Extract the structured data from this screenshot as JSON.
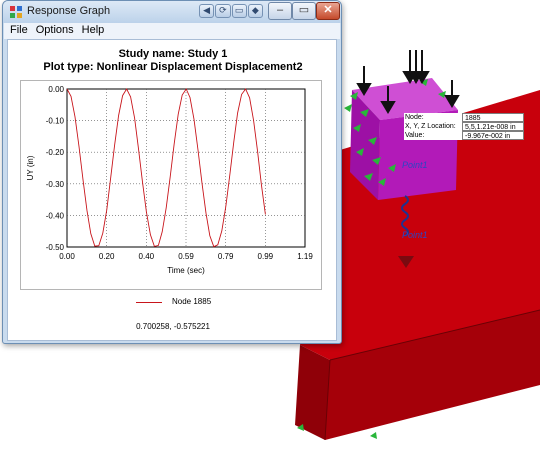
{
  "window": {
    "title": "Response Graph",
    "quick_buttons": [
      "◀",
      "⟳",
      "▭",
      "◆"
    ],
    "minimize": "–",
    "maximize": "▭",
    "close": "✕"
  },
  "menu": [
    "File",
    "Options",
    "Help"
  ],
  "plot": {
    "study_name": "Study name: Study 1",
    "plot_type": "Plot type: Nonlinear Displacement Displacement2",
    "legend_label": "Node 1885",
    "cursor_readout": "0.700258, -0.575221"
  },
  "chart_data": {
    "type": "line",
    "ylabel": "UY (in)",
    "xlabel": "Time (sec)",
    "xlim": [
      0.0,
      1.19
    ],
    "ylim": [
      -0.5,
      0.0
    ],
    "x_ticks": [
      "0.00",
      "0.20",
      "0.40",
      "0.59",
      "0.79",
      "0.99",
      "1.19"
    ],
    "y_ticks": [
      "0.00",
      "-0.10",
      "-0.20",
      "-0.30",
      "-0.40",
      "-0.50"
    ],
    "grid": true,
    "series": [
      {
        "name": "Node 1885",
        "color": "#c8151b",
        "x": [
          0.0,
          0.02,
          0.04,
          0.06,
          0.08,
          0.1,
          0.119,
          0.139,
          0.159,
          0.179,
          0.199,
          0.218,
          0.238,
          0.258,
          0.278,
          0.298,
          0.318,
          0.338,
          0.357,
          0.377,
          0.397,
          0.417,
          0.437,
          0.457,
          0.476,
          0.496,
          0.516,
          0.536,
          0.556,
          0.576,
          0.596,
          0.615,
          0.635,
          0.655,
          0.675,
          0.695,
          0.714,
          0.734,
          0.754,
          0.774,
          0.794,
          0.814,
          0.834,
          0.853,
          0.873,
          0.893,
          0.913,
          0.933,
          0.953,
          0.972,
          0.992
        ],
        "values": [
          0.0,
          -0.023,
          -0.088,
          -0.182,
          -0.287,
          -0.385,
          -0.458,
          -0.497,
          -0.496,
          -0.456,
          -0.382,
          -0.283,
          -0.178,
          -0.084,
          -0.021,
          0.0,
          -0.025,
          -0.092,
          -0.187,
          -0.292,
          -0.389,
          -0.461,
          -0.498,
          -0.495,
          -0.452,
          -0.376,
          -0.278,
          -0.173,
          -0.08,
          -0.019,
          0.0,
          -0.027,
          -0.096,
          -0.193,
          -0.298,
          -0.393,
          -0.464,
          -0.499,
          -0.493,
          -0.449,
          -0.372,
          -0.272,
          -0.167,
          -0.076,
          -0.017,
          0.0,
          -0.028,
          -0.1,
          -0.198,
          -0.303,
          -0.397
        ]
      }
    ]
  },
  "node_tooltip": {
    "rows": [
      {
        "key": "Node:",
        "value": "1885"
      },
      {
        "key": "X, Y, Z Location:",
        "value": "5,5,1.21e-008 in"
      },
      {
        "key": "Value:",
        "value": "-9.967e-002 in"
      }
    ]
  },
  "model_labels": {
    "point1": "Point1",
    "point2": "Point1"
  },
  "colors": {
    "slab": "#c8000c",
    "block": "#b21ab8",
    "fixture": "#29b63a",
    "load_arrow": "#111111",
    "spring": "#1f3290"
  }
}
